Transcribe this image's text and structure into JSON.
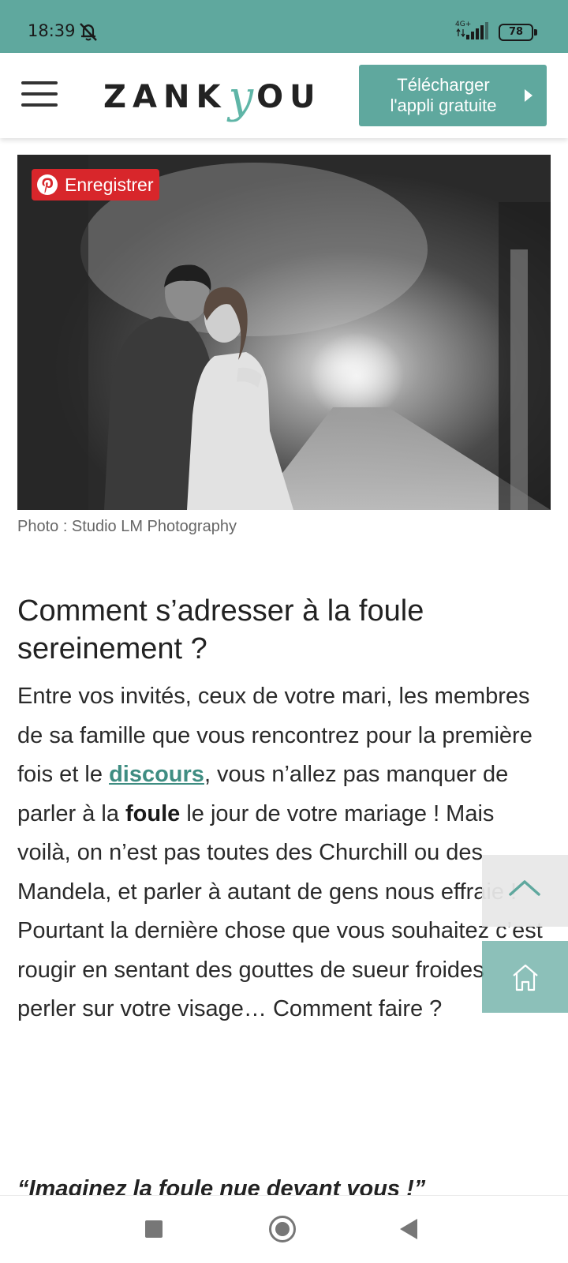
{
  "status_bar": {
    "time": "18:39",
    "network": "4G+",
    "battery": "78",
    "icons": [
      "muted-bell-icon",
      "signal-icon",
      "battery-icon"
    ]
  },
  "header": {
    "logo_prefix": "ZANK",
    "logo_y": "y",
    "logo_suffix": "OU",
    "download_line1": "Télécharger",
    "download_line2": "l'appli gratuite",
    "accent_color": "#5fa89e"
  },
  "photo": {
    "save_button": "Enregistrer",
    "caption": "Photo : Studio LM Photography"
  },
  "article": {
    "title": "Comment s’adresser à la foule sereinement ?",
    "p1_a": "Entre vos invités, ceux de votre mari, les membres de sa famille que vous rencontrez pour la première fois et le ",
    "p1_link": "discours",
    "p1_b": ", vous n’allez pas manquer de parler à la ",
    "p1_bold": "foule",
    "p1_c": " le jour de votre mariage ! Mais voilà, on n’est pas toutes des Churchill ou des Mandela, et parler à autant de gens nous effraie ! Pourtant la dernière chose que vous souhaitez c’est rougir en sentant des gouttes de sueur froides perler sur votre visage… Comment faire ?",
    "next_heading": "“Imaginez la foule nue devant vous !”"
  },
  "floating": {
    "scroll_top_icon": "chevron-up-icon",
    "home_icon": "home-icon"
  },
  "navbar": {
    "icons": [
      "recent-apps-icon",
      "home-circle-icon",
      "back-triangle-icon"
    ]
  }
}
